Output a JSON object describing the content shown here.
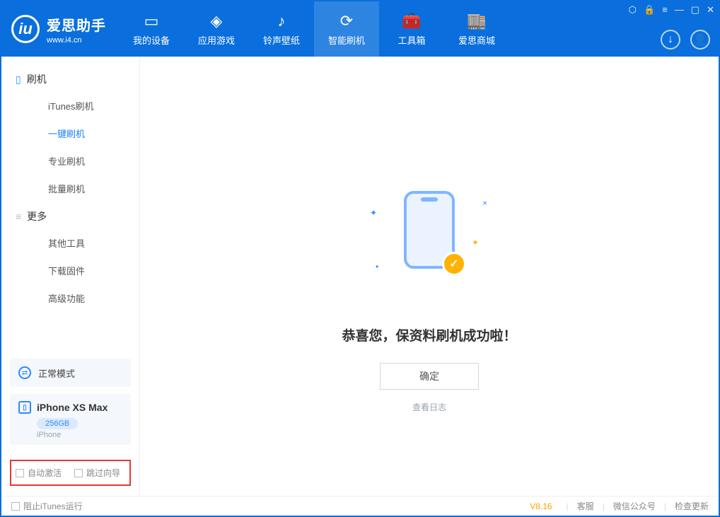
{
  "brand": {
    "title": "爱思助手",
    "sub": "www.i4.cn"
  },
  "top_tabs": [
    {
      "label": "我的设备",
      "icon": "▭"
    },
    {
      "label": "应用游戏",
      "icon": "◈"
    },
    {
      "label": "铃声壁纸",
      "icon": "♪"
    },
    {
      "label": "智能刷机",
      "icon": "⟳",
      "active": true
    },
    {
      "label": "工具箱",
      "icon": "🧰"
    },
    {
      "label": "爱思商城",
      "icon": "🏬"
    }
  ],
  "sidebar": {
    "groups": [
      {
        "title": "刷机",
        "icon": "device-icon",
        "items": [
          "iTunes刷机",
          "一键刷机",
          "专业刷机",
          "批量刷机"
        ],
        "active_index": 1
      },
      {
        "title": "更多",
        "icon": "menu-icon",
        "items": [
          "其他工具",
          "下载固件",
          "高级功能"
        ]
      }
    ],
    "mode": "正常模式",
    "device": {
      "name": "iPhone XS Max",
      "capacity": "256GB",
      "type": "iPhone"
    },
    "checks": {
      "auto_activate": "自动激活",
      "skip_guide": "跳过向导"
    }
  },
  "main": {
    "success_msg": "恭喜您，保资料刷机成功啦！",
    "ok_button": "确定",
    "view_log": "查看日志"
  },
  "footer": {
    "block_itunes": "阻止iTunes运行",
    "version": "V8.16",
    "links": [
      "客服",
      "微信公众号",
      "检查更新"
    ]
  }
}
